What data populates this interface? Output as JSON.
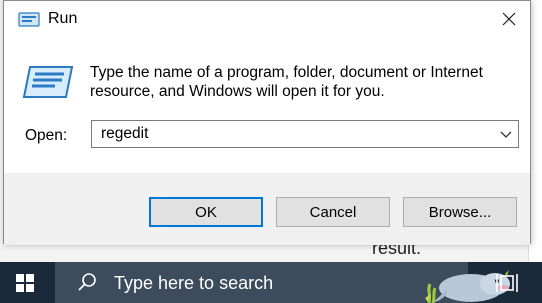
{
  "dialog": {
    "title": "Run",
    "message": "Type the name of a program, folder, document or Internet resource, and Windows will open it for you.",
    "open_label": "Open:",
    "open_value": "regedit",
    "buttons": {
      "ok": "OK",
      "cancel": "Cancel",
      "browse": "Browse..."
    }
  },
  "background": {
    "partial_text": "result."
  },
  "taskbar": {
    "search_placeholder": "Type here to search"
  },
  "icons": {
    "title": "run-icon",
    "close": "close-icon",
    "big": "run-app-icon",
    "dropdown": "chevron-down-icon",
    "start": "windows-logo-icon",
    "search": "search-icon",
    "search_art": "manatee-illustration",
    "task_view": "task-view-icon"
  },
  "colors": {
    "accent": "#0078d7",
    "taskbar": "#1b2a3a",
    "search_box": "#3d4c5c"
  }
}
